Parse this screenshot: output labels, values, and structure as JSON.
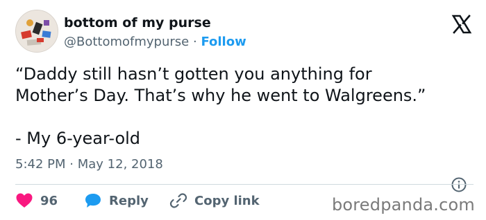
{
  "author": {
    "name": "bottom of my purse",
    "handle": "@Bottomofmypurse",
    "separator": "·",
    "follow_label": "Follow"
  },
  "tweet": {
    "text": "“Daddy still hasn’t gotten you anything for\nMother’s Day. That’s why he went to Walgreens.”\n\n- My 6-year-old",
    "time": "5:42 PM",
    "separator": "·",
    "date": "May 12, 2018"
  },
  "actions": {
    "like_count": "96",
    "reply_label": "Reply",
    "copy_label": "Copy link"
  },
  "watermark": "boredpanda.com",
  "colors": {
    "accent": "#1d9bf0",
    "like": "#f91880",
    "secondary_text": "#536471",
    "divider": "#cfd9de"
  },
  "icons": [
    "x-logo-icon",
    "info-icon",
    "heart-icon",
    "reply-bubble-icon",
    "link-icon"
  ]
}
